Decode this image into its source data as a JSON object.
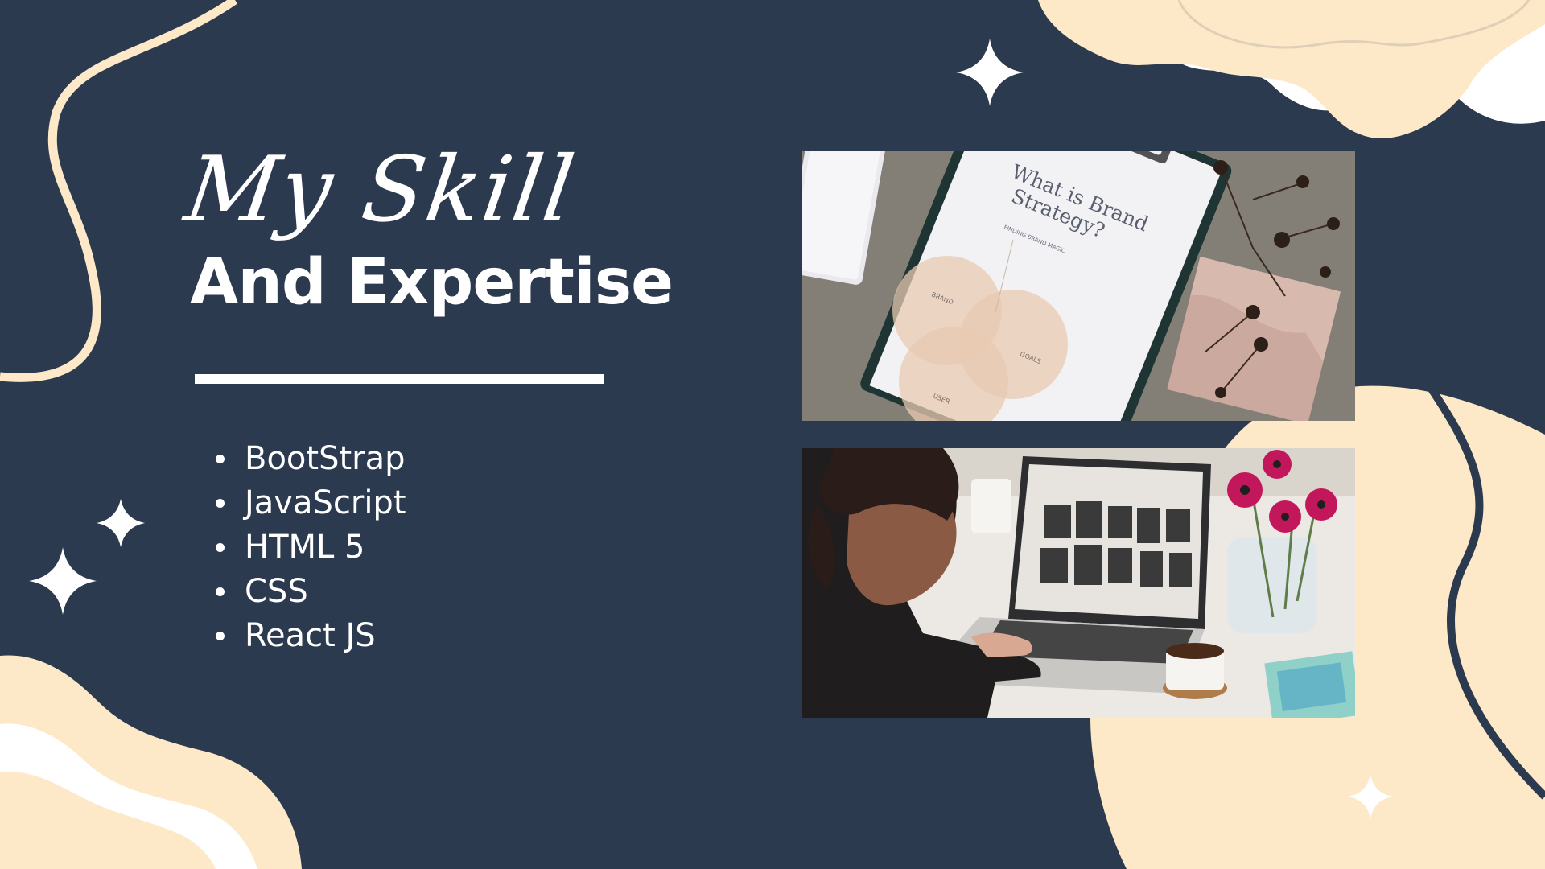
{
  "script_title": "My Skill",
  "main_title": "And Expertise",
  "skills": [
    "BootStrap",
    "JavaScript",
    "HTML 5",
    "CSS",
    "React JS"
  ],
  "photos": {
    "top": {
      "heading": "What is Brand Strategy?",
      "heading_line1": "What is Brand",
      "heading_line2": "Strategy?",
      "subtitle": "FINDING BRAND MAGIC",
      "circles": [
        "BRAND",
        "GOALS",
        "USER"
      ]
    },
    "bottom": {
      "subject": "woman-browsing-on-laptop"
    }
  },
  "colors": {
    "background": "#2c3a4f",
    "cream": "#fde9c8",
    "white": "#ffffff"
  }
}
